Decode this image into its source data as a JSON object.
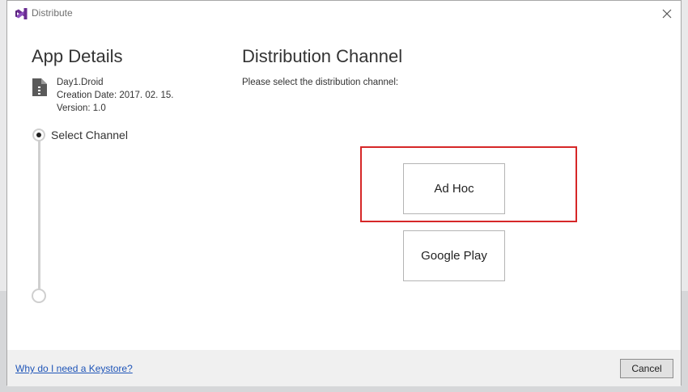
{
  "window": {
    "title": "Distribute",
    "icon": "visual-studio-icon",
    "close_icon": "close-icon"
  },
  "colors": {
    "accent_purple": "#6a2c91",
    "highlight_red": "#d62728",
    "link_blue": "#1f55b8",
    "footer_bg": "#f0f0f0"
  },
  "app_details": {
    "title": "App Details",
    "icon": "document-icon",
    "name": "Day1.Droid",
    "creation_date": "Creation Date: 2017. 02. 15.",
    "version": "Version: 1.0"
  },
  "steps": [
    {
      "label": "Select Channel",
      "state": "active"
    },
    {
      "label": "",
      "state": "pending"
    }
  ],
  "distribution": {
    "title": "Distribution Channel",
    "instruction": "Please select the distribution channel:",
    "options": [
      {
        "label": "Ad Hoc",
        "highlighted": true
      },
      {
        "label": "Google Play",
        "highlighted": false
      }
    ]
  },
  "footer": {
    "link_text": "Why do I need a Keystore?",
    "cancel_label": "Cancel"
  }
}
